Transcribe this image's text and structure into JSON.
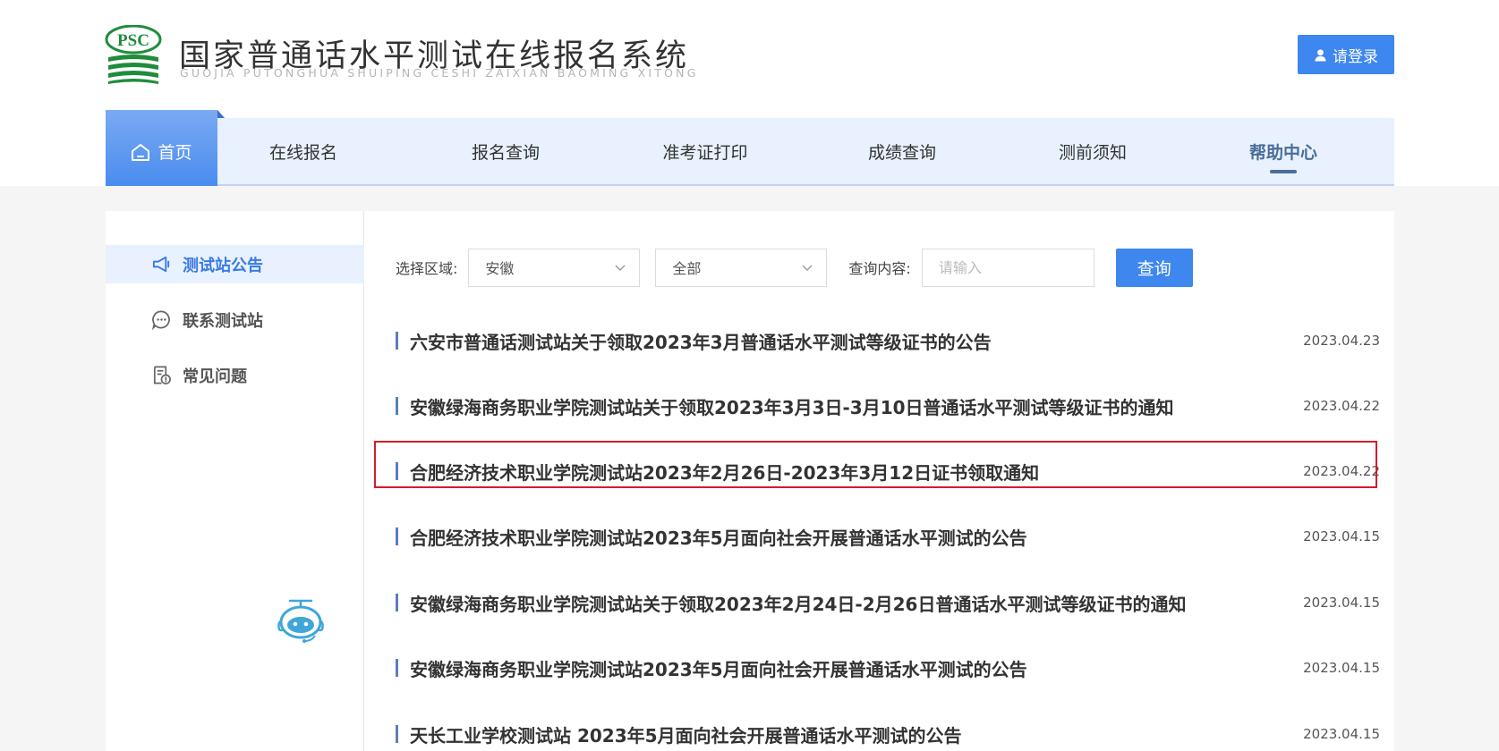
{
  "header": {
    "logo_text": "PSC",
    "title": "国家普通话水平测试在线报名系统",
    "subtitle": "GUOJIA PUTONGHUA SHUIPING CESHI ZAIXIAN BAOMING XITONG",
    "login_label": "请登录"
  },
  "nav": {
    "items": [
      {
        "label": "首页"
      },
      {
        "label": "在线报名"
      },
      {
        "label": "报名查询"
      },
      {
        "label": "准考证打印"
      },
      {
        "label": "成绩查询"
      },
      {
        "label": "测前须知"
      },
      {
        "label": "帮助中心"
      }
    ],
    "active": "帮助中心"
  },
  "sidebar": {
    "items": [
      {
        "label": "测试站公告",
        "icon": "megaphone-icon"
      },
      {
        "label": "联系测试站",
        "icon": "chat-icon"
      },
      {
        "label": "常见问题",
        "icon": "faq-icon"
      }
    ]
  },
  "filters": {
    "region_label": "选择区域:",
    "region_value": "安徽",
    "category_value": "全部",
    "query_label": "查询内容:",
    "query_placeholder": "请输入",
    "search_label": "查询"
  },
  "notices": [
    {
      "title": "六安市普通话测试站关于领取2023年3月普通话水平测试等级证书的公告",
      "date": "2023.04.23"
    },
    {
      "title": "安徽绿海商务职业学院测试站关于领取2023年3月3日-3月10日普通话水平测试等级证书的通知",
      "date": "2023.04.22"
    },
    {
      "title": "合肥经济技术职业学院测试站2023年2月26日-2023年3月12日证书领取通知",
      "date": "2023.04.22"
    },
    {
      "title": "合肥经济技术职业学院测试站2023年5月面向社会开展普通话水平测试的公告",
      "date": "2023.04.15"
    },
    {
      "title": "安徽绿海商务职业学院测试站关于领取2023年2月24日-2月26日普通话水平测试等级证书的通知",
      "date": "2023.04.15"
    },
    {
      "title": "安徽绿海商务职业学院测试站2023年5月面向社会开展普通话水平测试的公告",
      "date": "2023.04.15"
    },
    {
      "title": "天长工业学校测试站 2023年5月面向社会开展普通话水平测试的公告",
      "date": "2023.04.15"
    }
  ],
  "colors": {
    "primary": "#3d87ee",
    "nav_bg": "#e8f1fd",
    "highlight": "#d21d2b",
    "logo_green": "#1f8c3b"
  }
}
